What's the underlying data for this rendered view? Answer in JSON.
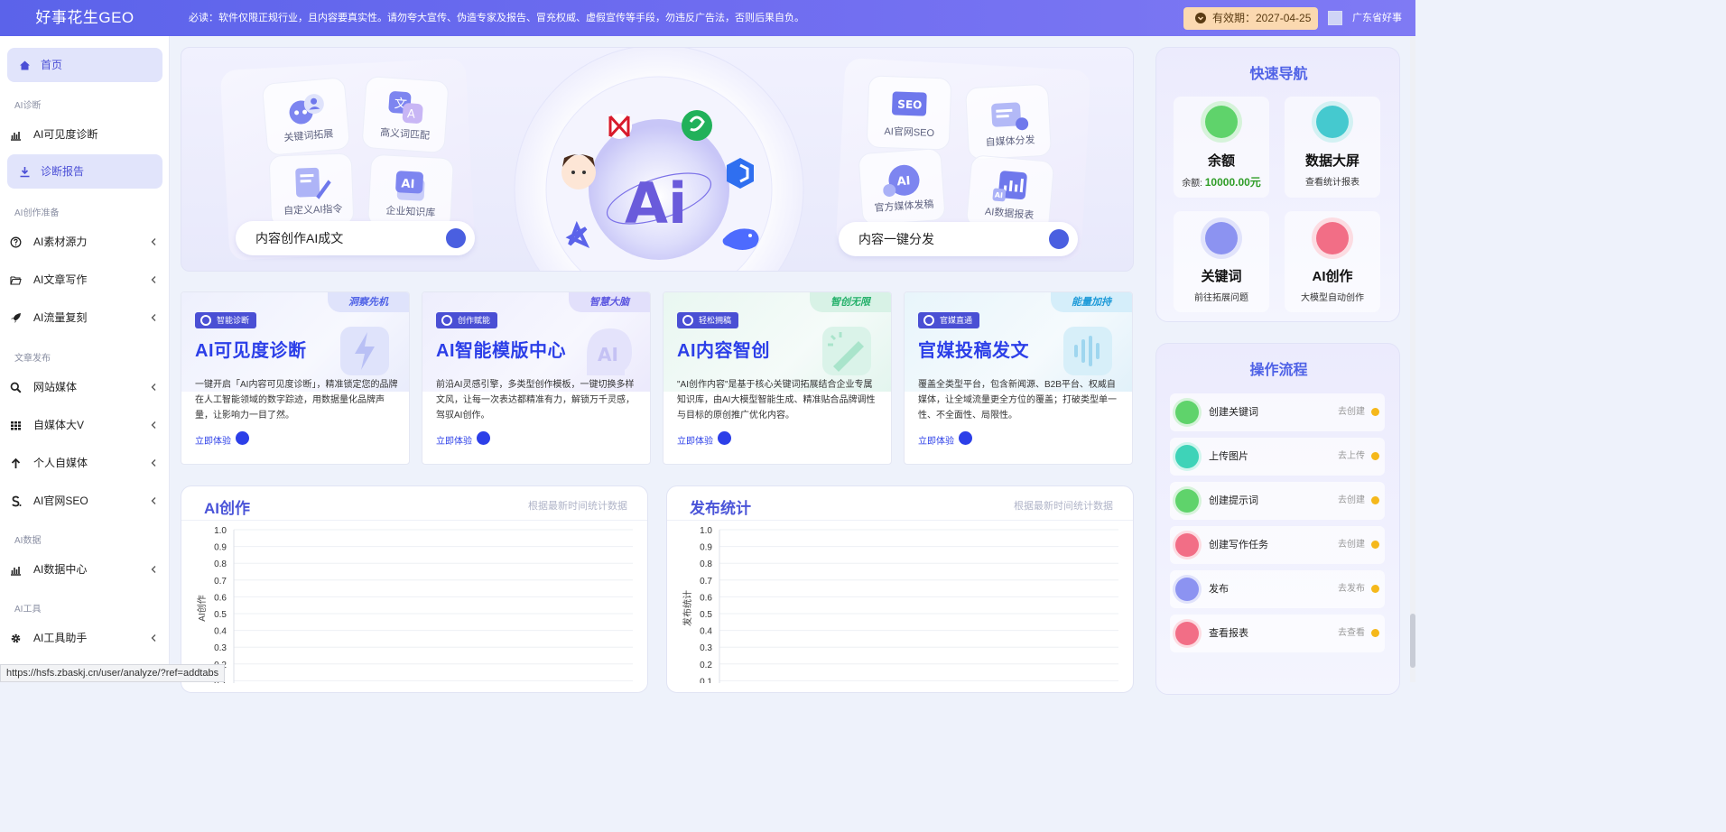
{
  "header": {
    "logo": "好事花生GEO",
    "notice": "必读：软件仅限正规行业，且内容要真实性。请勿夸大宣传、伪造专家及报告、冒充权威、虚假宣传等手段，勿违反广告法，否则后果自负。",
    "validity": "有效期：2027-04-25",
    "user": "广东省好事"
  },
  "sidebar": {
    "home": "首页",
    "groups": {
      "ai_diag": "AI诊断",
      "ai_prep": "AI创作准备",
      "publish": "文章发布",
      "ai_data": "AI数据",
      "ai_tools": "AI工具"
    },
    "items": {
      "visibility": "AI可见度诊断",
      "report": "诊断报告",
      "material": "AI素材源力",
      "article": "AI文章写作",
      "traffic": "AI流量复刻",
      "site_media": "网站媒体",
      "self_media_v": "自媒体大V",
      "personal_media": "个人自媒体",
      "seo": "AI官网SEO",
      "data_center": "AI数据中心",
      "tool_helper": "AI工具助手"
    }
  },
  "status_url": "https://hsfs.zbaskj.cn/user/analyze/?ref=addtabs",
  "hero": {
    "left_tiles": [
      "关键词拓展",
      "高义词匹配",
      "自定义AI指令",
      "企业知识库"
    ],
    "left_pill": "内容创作AI成文",
    "center_text": "Ai",
    "right_tiles": [
      "AI官网SEO",
      "自媒体分发",
      "官方媒体发稿",
      "AI数据报表"
    ],
    "right_tile_badges": [
      "SEO",
      "AI",
      "AI"
    ],
    "right_pill": "内容一键分发"
  },
  "cards": [
    {
      "ribbon": "洞察先机",
      "tag": "智能诊断",
      "title": "AI可见度诊断",
      "desc": "一键开启「AI内容可见度诊断」，精准锁定您的品牌在人工智能领域的数字踪迹，用数据量化品牌声量，让影响力一目了然。",
      "action": "立即体验"
    },
    {
      "ribbon": "智慧大脑",
      "tag": "创作赋能",
      "title": "AI智能模版中心",
      "desc": "前沿AI灵感引擎，多类型创作模板，一键切换多样文风，让每一次表达都精准有力，解锁万千灵感，驾驭AI创作。",
      "action": "立即体验",
      "decor_text": "AI"
    },
    {
      "ribbon": "智创无限",
      "tag": "轻松拥稿",
      "title": "AI内容智创",
      "desc": "\"AI创作内容\"是基于核心关键词拓展结合企业专属知识库，由AI大模型智能生成、精准贴合品牌调性与目标的原创推广优化内容。",
      "action": "立即体验"
    },
    {
      "ribbon": "能量加持",
      "tag": "官媒直通",
      "title": "官媒投稿发文",
      "desc": "覆盖全类型平台，包含新闻源、B2B平台、权威自媒体，让全域流量更全方位的覆盖；打破类型单一性、不全面性、局限性。",
      "action": "立即体验"
    }
  ],
  "charts": [
    {
      "title": "AI创作",
      "subtitle": "根据最新时间统计数据",
      "ylabel": "AI创作",
      "ticks": [
        "1.0",
        "0.9",
        "0.8",
        "0.7",
        "0.6",
        "0.5",
        "0.4",
        "0.3",
        "0.2",
        "0.1"
      ]
    },
    {
      "title": "发布统计",
      "subtitle": "根据最新时间统计数据",
      "ylabel": "发布统计",
      "ticks": [
        "1.0",
        "0.9",
        "0.8",
        "0.7",
        "0.6",
        "0.5",
        "0.4",
        "0.3",
        "0.2",
        "0.1"
      ]
    }
  ],
  "chart_data": [
    {
      "type": "line",
      "title": "AI创作",
      "subtitle": "根据最新时间统计数据",
      "ylabel": "AI创作",
      "xlabel": "",
      "ylim": [
        0,
        1.0
      ],
      "categories": [],
      "series": [],
      "grid": true
    },
    {
      "type": "line",
      "title": "发布统计",
      "subtitle": "根据最新时间统计数据",
      "ylabel": "发布统计",
      "xlabel": "",
      "ylim": [
        0,
        1.0
      ],
      "categories": [],
      "series": [],
      "grid": true
    }
  ],
  "quick_nav": {
    "title": "快速导航",
    "items": [
      {
        "title": "余额",
        "sub_label": "余额:",
        "sub_value": "10000.00元",
        "icon": "document-icon",
        "color": "#5fd36b"
      },
      {
        "title": "数据大屏",
        "sub": "查看统计报表",
        "icon": "monitor-icon",
        "color": "#45c9cf"
      },
      {
        "title": "关键词",
        "sub": "前往拓展问题",
        "icon": "cloud-icon",
        "color": "#8c93f1"
      },
      {
        "title": "AI创作",
        "sub": "大模型自动创作",
        "icon": "basket-icon",
        "color": "#f26e86"
      }
    ]
  },
  "workflow": {
    "title": "操作流程",
    "steps": [
      {
        "label": "创建关键词",
        "action": "去创建",
        "icon": "document-icon",
        "color": "#5fd36b"
      },
      {
        "label": "上传图片",
        "action": "去上传",
        "icon": "wallet-icon",
        "color": "#3ed3b8"
      },
      {
        "label": "创建提示词",
        "action": "去创建",
        "icon": "document-icon",
        "color": "#5fd36b"
      },
      {
        "label": "创建写作任务",
        "action": "去创建",
        "icon": "doc-edit-icon",
        "color": "#f26e86"
      },
      {
        "label": "发布",
        "action": "去发布",
        "icon": "cloud-icon",
        "color": "#8c93f1"
      },
      {
        "label": "查看报表",
        "action": "去查看",
        "icon": "basket-icon",
        "color": "#f26e86"
      }
    ]
  }
}
